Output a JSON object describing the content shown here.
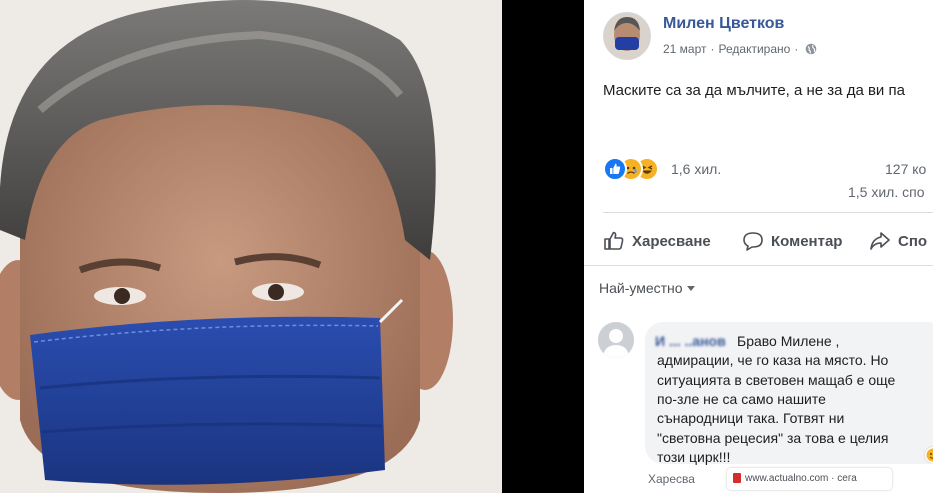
{
  "post": {
    "author": "Милен Цветков",
    "date": "21 март",
    "dot": "·",
    "edited": "Редактирано",
    "text": "Маските са за да мълчите, а не за да ви па",
    "reaction_icons": [
      "like-icon",
      "sad-icon",
      "haha-icon"
    ],
    "reaction_count": "1,6 хил.",
    "comments_count": "127 ко",
    "shares_count": "1,5 хил. спо"
  },
  "actions": {
    "like": "Харесване",
    "comment": "Коментар",
    "share": "Спо"
  },
  "sort": {
    "label": "Най-уместно"
  },
  "comment": {
    "name": "И ... ..анов",
    "lines": [
      "Браво Милене ,",
      "адмирации, че го каза на място. Но",
      "ситуацията в световен мащаб е още",
      "по-зле не са само нашите",
      "сънародници така. Готвят ни",
      "\"световна рецесия\" за това е целия",
      "този цирк!!!"
    ],
    "reply_bar": "Харесва",
    "source": "www.actualno.com",
    "source_suffix": "· сега"
  },
  "colors": {
    "link": "#385898",
    "mask": "#1f3f9e",
    "like": "#1877f2",
    "emoji": "#f7b125"
  }
}
